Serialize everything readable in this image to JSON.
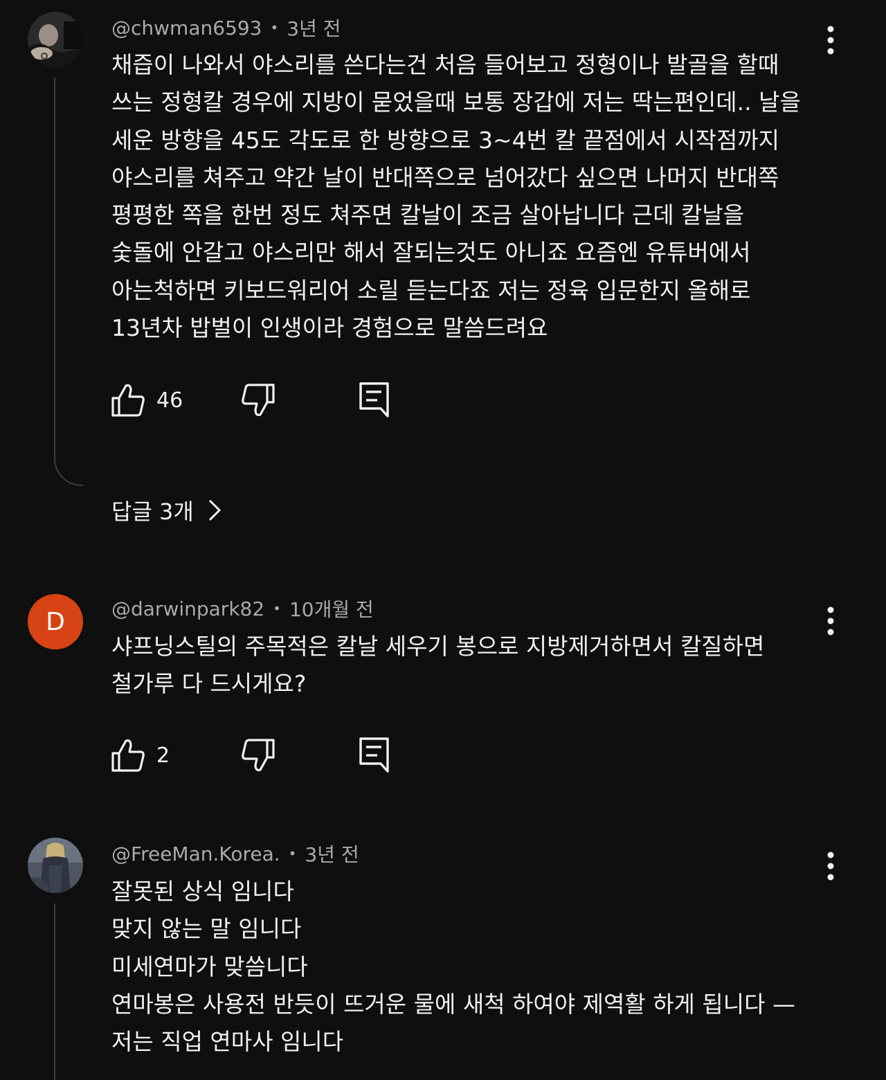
{
  "comments": [
    {
      "author": "@chwman6593",
      "time": "3년 전",
      "lines": [
        "채즙이 나와서 야스리를 쓴다는건 처음 들어보고 정형이나 발골을 할때",
        "쓰는 정형칼 경우에 지방이 묻었을때 보통 장갑에 저는 딱는편인데.. 날을",
        "세운 방향을 45도 각도로 한 방향으로 3~4번 칼 끝점에서 시작점까지",
        "야스리를 쳐주고 약간 날이 반대쪽으로 넘어갔다 싶으면 나머지 반대쪽",
        "평평한 쪽을 한번 정도 쳐주면 칼날이 조금 살아납니다 근데 칼날을",
        "숯돌에 안갈고 야스리만 해서 잘되는것도 아니죠 요즘엔 유튜버에서",
        "아는척하면 키보드워리어 소릴 듣는다죠 저는 정육 입문한지 올해로",
        "13년차 밥벌이 인생이라 경험으로 말씀드려요"
      ],
      "likes": "46",
      "replies_label": "답글 3개"
    },
    {
      "author": "@darwinpark82",
      "time": "10개월 전",
      "avatar_letter": "D",
      "avatar_color": "#d84315",
      "lines": [
        "샤프닝스틸의 주목적은 칼날 세우기 봉으로 지방제거하면서 칼질하면",
        "철가루 다 드시게요?"
      ],
      "likes": "2"
    },
    {
      "author": "@FreeMan.Korea.",
      "time": "3년 전",
      "lines": [
        "잘못된 상식 임니다",
        "맞지 않는 말 임니다",
        "미세연마가 맞씀니다",
        "연마봉은 사용전 반듯이 뜨거운 물에 새척 하여야 제역활 하게 됩니다 —",
        "저는 직업 연마사 임니다"
      ]
    }
  ],
  "icons": {
    "like": "thumbs-up-icon",
    "dislike": "thumbs-down-icon",
    "reply": "reply-comment-icon",
    "menu": "more-vertical-icon",
    "chevron": "chevron-right-icon"
  },
  "colors": {
    "background": "#0f0f0f",
    "text_primary": "#f1f1f1",
    "text_secondary": "#aaaaaa",
    "thread_line": "#3d3d3d"
  }
}
